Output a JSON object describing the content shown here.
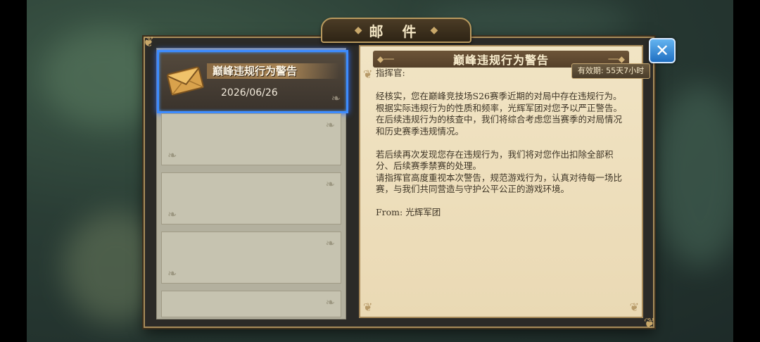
{
  "window": {
    "title": "邮 件"
  },
  "close_button": {
    "label": "✕"
  },
  "mail_list": {
    "items": [
      {
        "title": "巅峰违规行为警告",
        "date": "2026/06/26",
        "icon": "envelope-icon",
        "selected": true
      }
    ],
    "empty_slots": 4
  },
  "detail": {
    "title": "巅峰违规行为警告",
    "expiry": "有效期: 55天7小时",
    "greeting": "指挥官:",
    "paragraphs": [
      "经核实，您在巅峰竞技场S26赛季近期的对局中存在违规行为。",
      "根据实际违规行为的性质和频率，光辉军团对您予以严正警告。",
      "在后续违规行为的核查中，我们将综合考虑您当赛季的对局情况和历史赛季违规情况。",
      "若后续再次发现您存在违规行为，我们将对您作出扣除全部积分、后续赛季禁赛的处理。",
      "请指挥官高度重视本次警告，规范游戏行为，认真对待每一场比赛，与我们共同营造与守护公平公正的游戏环境。"
    ],
    "from": "From:  光辉军团"
  },
  "colors": {
    "selection_border": "#3d8cff",
    "close_button": "#2f82d8",
    "parchment": "#efe1bf",
    "header_brown": "#5e4830"
  }
}
